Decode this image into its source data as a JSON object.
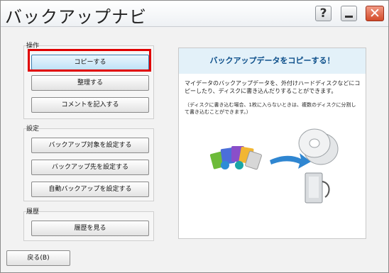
{
  "window": {
    "title": "バックアップナビ",
    "help_label": "?",
    "close_label": "✕"
  },
  "groups": {
    "operation": {
      "label": "操作",
      "buttons": [
        "コピーする",
        "整理する",
        "コメントを記入する"
      ]
    },
    "settings": {
      "label": "設定",
      "buttons": [
        "バックアップ対象を設定する",
        "バックアップ先を設定する",
        "自動バックアップを設定する"
      ]
    },
    "history": {
      "label": "履歴",
      "buttons": [
        "履歴を見る"
      ]
    }
  },
  "panel": {
    "title": "バックアップデータをコピーする！",
    "description": "マイデータのバックアップデータを、外付けハードディスクなどにコピーしたり、ディスクに書き込んだりすることができます。",
    "note": "（ディスクに書き込む場合、1枚に入らないときは、複数のディスクに分割して書き込むことができます。）"
  },
  "footer": {
    "back_label": "戻る(B)"
  },
  "colors": {
    "highlight": "#e00000",
    "panel_title": "#0d4f8a",
    "panel_header_bg": "#e3f1f9",
    "close_button": "#d24b2a"
  }
}
